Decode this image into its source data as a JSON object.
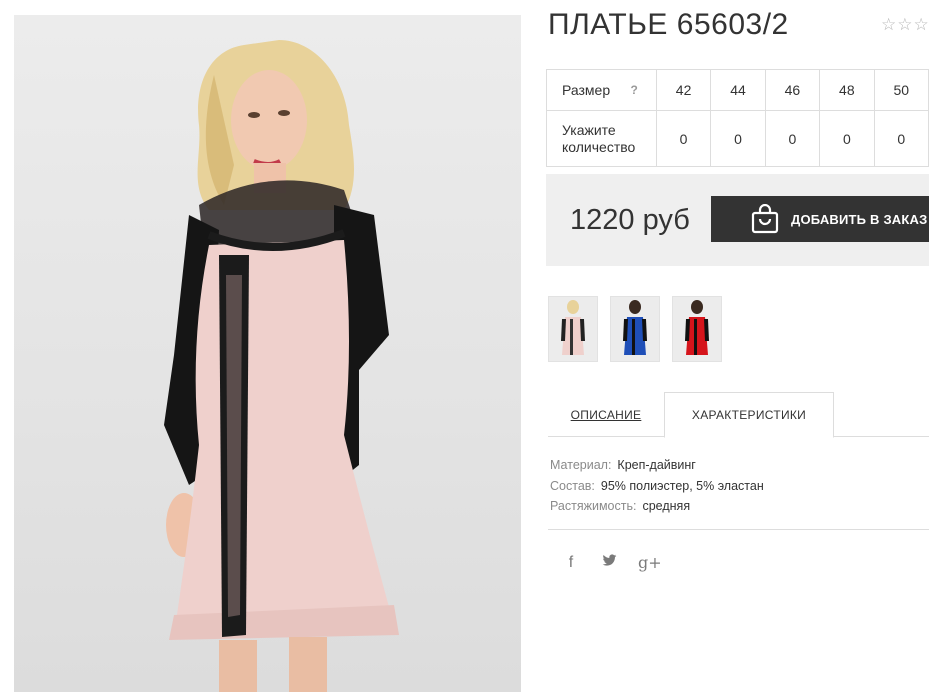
{
  "product": {
    "title": "ПЛАТЬЕ 65603/2",
    "rating_stars": 3,
    "rating_glyph": "☆"
  },
  "size_table": {
    "size_label": "Размер",
    "help_mark": "?",
    "quantity_label": "Укажите количество",
    "sizes": [
      "42",
      "44",
      "46",
      "48",
      "50"
    ],
    "quantities": [
      "0",
      "0",
      "0",
      "0",
      "0"
    ]
  },
  "buy": {
    "price": "1220 руб",
    "button_label": "ДОБАВИТЬ В ЗАКАЗ"
  },
  "thumbnails": [
    {
      "color": "pink-black",
      "name": "thumb-pink-dress"
    },
    {
      "color": "blue-black",
      "name": "thumb-blue-dress"
    },
    {
      "color": "red-black",
      "name": "thumb-red-dress"
    }
  ],
  "tabs": {
    "description": "ОПИСАНИЕ",
    "characteristics": "ХАРАКТЕРИСТИКИ",
    "active": "characteristics"
  },
  "characteristics": [
    {
      "key": "Материал:",
      "value": "Креп-дайвинг"
    },
    {
      "key": "Состав:",
      "value": "95% полиэстер, 5% эластан"
    },
    {
      "key": "Растяжимость:",
      "value": "средняя"
    }
  ],
  "share": {
    "facebook": "f",
    "twitter": "t",
    "google_plus": "g+"
  },
  "colors": {
    "button_bg": "#333333",
    "buy_box_bg": "#efefef",
    "border": "#dddddd",
    "dress_pink": "#efd0cc",
    "dress_blue": "#1f4fb8",
    "dress_red": "#d5141b"
  }
}
